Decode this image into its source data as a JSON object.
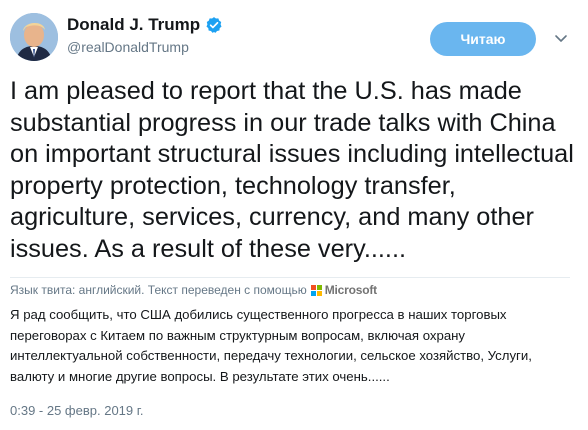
{
  "author": {
    "display_name": "Donald J. Trump",
    "handle": "@realDonaldTrump",
    "verified": true
  },
  "follow_button_label": "Читаю",
  "tweet_text": "I am pleased to report that the U.S. has made substantial progress in our trade talks with China on important structural issues including intellectual property protection, technology transfer, agriculture, services, currency, and many other issues. As a result of these very......",
  "translation": {
    "language_label": "Язык твита: английский. Текст переведен с помощью",
    "provider": "Microsoft",
    "text": "Я рад сообщить, что США добились существенного прогресса в наших торговых переговорах с Китаем по важным структурным вопросам, включая охрану интеллектуальной собственности, передачу технологии, сельское хозяйство, Услуги, валюту и многие другие вопросы. В результате этих очень......"
  },
  "timestamp": "0:39 - 25 февр. 2019 г.",
  "colors": {
    "follow_button": "#6ab6ef",
    "verified_badge": "#1da1f2",
    "secondary_text": "#657786"
  },
  "icons": {
    "verified": "verified-badge-icon",
    "caret": "chevron-down-icon",
    "translation_provider": "microsoft-logo-icon"
  }
}
